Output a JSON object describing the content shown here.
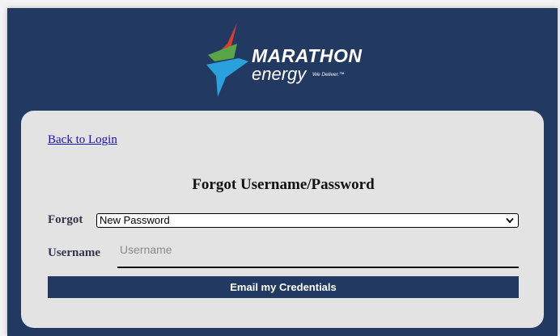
{
  "brand": {
    "name_line1": "MARATHON",
    "name_line2": "energy",
    "tagline": "We Deliver.™",
    "colors": {
      "navy": "#223a62",
      "red": "#e23a2e",
      "green": "#5aa646",
      "blue": "#2aa0dc"
    }
  },
  "nav": {
    "back_link": "Back to Login"
  },
  "form": {
    "title": "Forgot Username/Password",
    "forgot_label": "Forgot",
    "forgot_selected": "New Password",
    "username_label": "Username",
    "username_placeholder": "Username",
    "username_value": "",
    "submit_label": "Email my Credentials"
  }
}
